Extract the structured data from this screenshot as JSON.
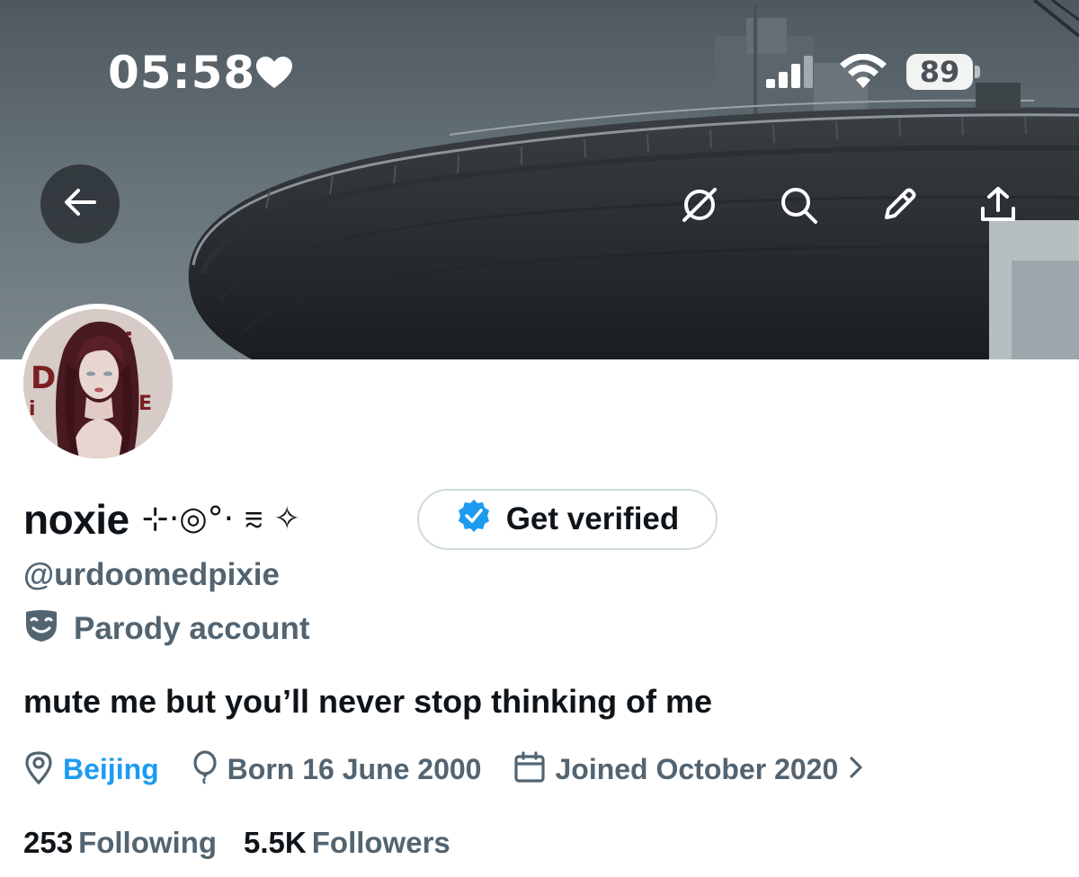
{
  "status_bar": {
    "time": "05:58",
    "battery": "89",
    "icons": [
      "heart-icon",
      "cellular-signal-icon",
      "wifi-icon",
      "battery-icon"
    ]
  },
  "header_actions": {
    "back": "back-arrow-icon",
    "actions": [
      "grok-icon",
      "search-icon",
      "edit-icon",
      "share-icon"
    ]
  },
  "profile": {
    "display_name": "noxie",
    "name_decoration": "⊹·◎°· ⩳ ✧",
    "verify_label": "Get verified",
    "handle": "@urdoomedpixie",
    "label": "Parody account",
    "bio": "mute me but you’ll never stop thinking of me",
    "location": "Beijing",
    "birthday": "Born 16 June 2000",
    "joined": "Joined October 2020",
    "following_count": "253",
    "following_label": "Following",
    "followers_count": "5.5K",
    "followers_label": "Followers"
  },
  "colors": {
    "text_primary": "#0f1419",
    "text_secondary": "#536471",
    "link": "#1d9bf0",
    "verified_badge": "#1d9bf0",
    "border": "#cfd9de"
  }
}
